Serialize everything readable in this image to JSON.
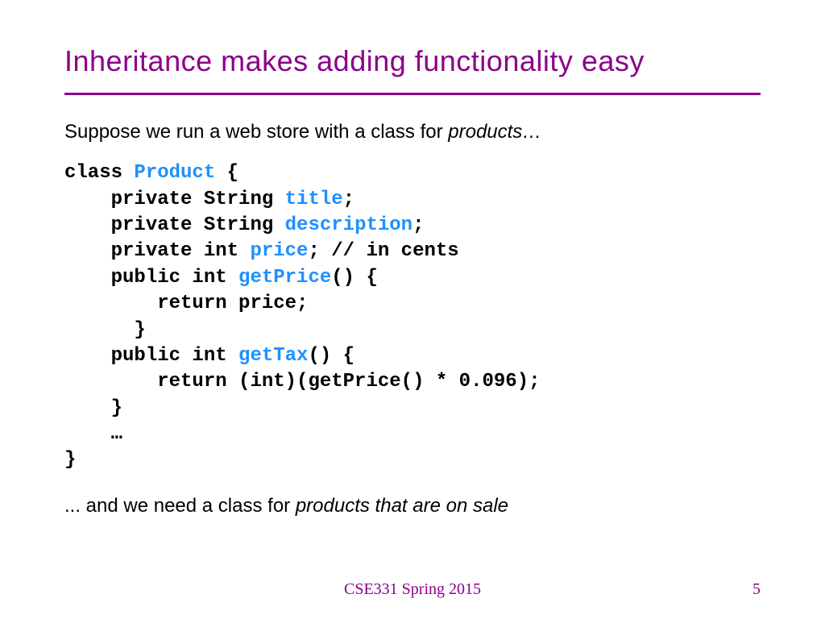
{
  "title": "Inheritance makes adding functionality easy",
  "intro_prefix": "Suppose we run a web store with a class for ",
  "intro_italic": "products…",
  "code": {
    "l1a": "class ",
    "l1b": "Product",
    "l1c": " {",
    "l2a": "    private String ",
    "l2b": "title",
    "l2c": ";",
    "l3a": "    private String ",
    "l3b": "description",
    "l3c": ";",
    "l4a": "    private int ",
    "l4b": "price",
    "l4c": "; // in cents",
    "l5a": "    public int ",
    "l5b": "getPrice",
    "l5c": "() {",
    "l6": "        return price;",
    "l7": "      }",
    "l8a": "    public int ",
    "l8b": "getTax",
    "l8c": "() {",
    "l9": "        return (int)(getPrice() * 0.096);",
    "l10": "    }",
    "l11": "    …",
    "l12": "}"
  },
  "outro_prefix": "... and we need a class for ",
  "outro_italic": "products that are on sale",
  "footer": {
    "course": "CSE331 Spring 2015",
    "page": "5"
  }
}
